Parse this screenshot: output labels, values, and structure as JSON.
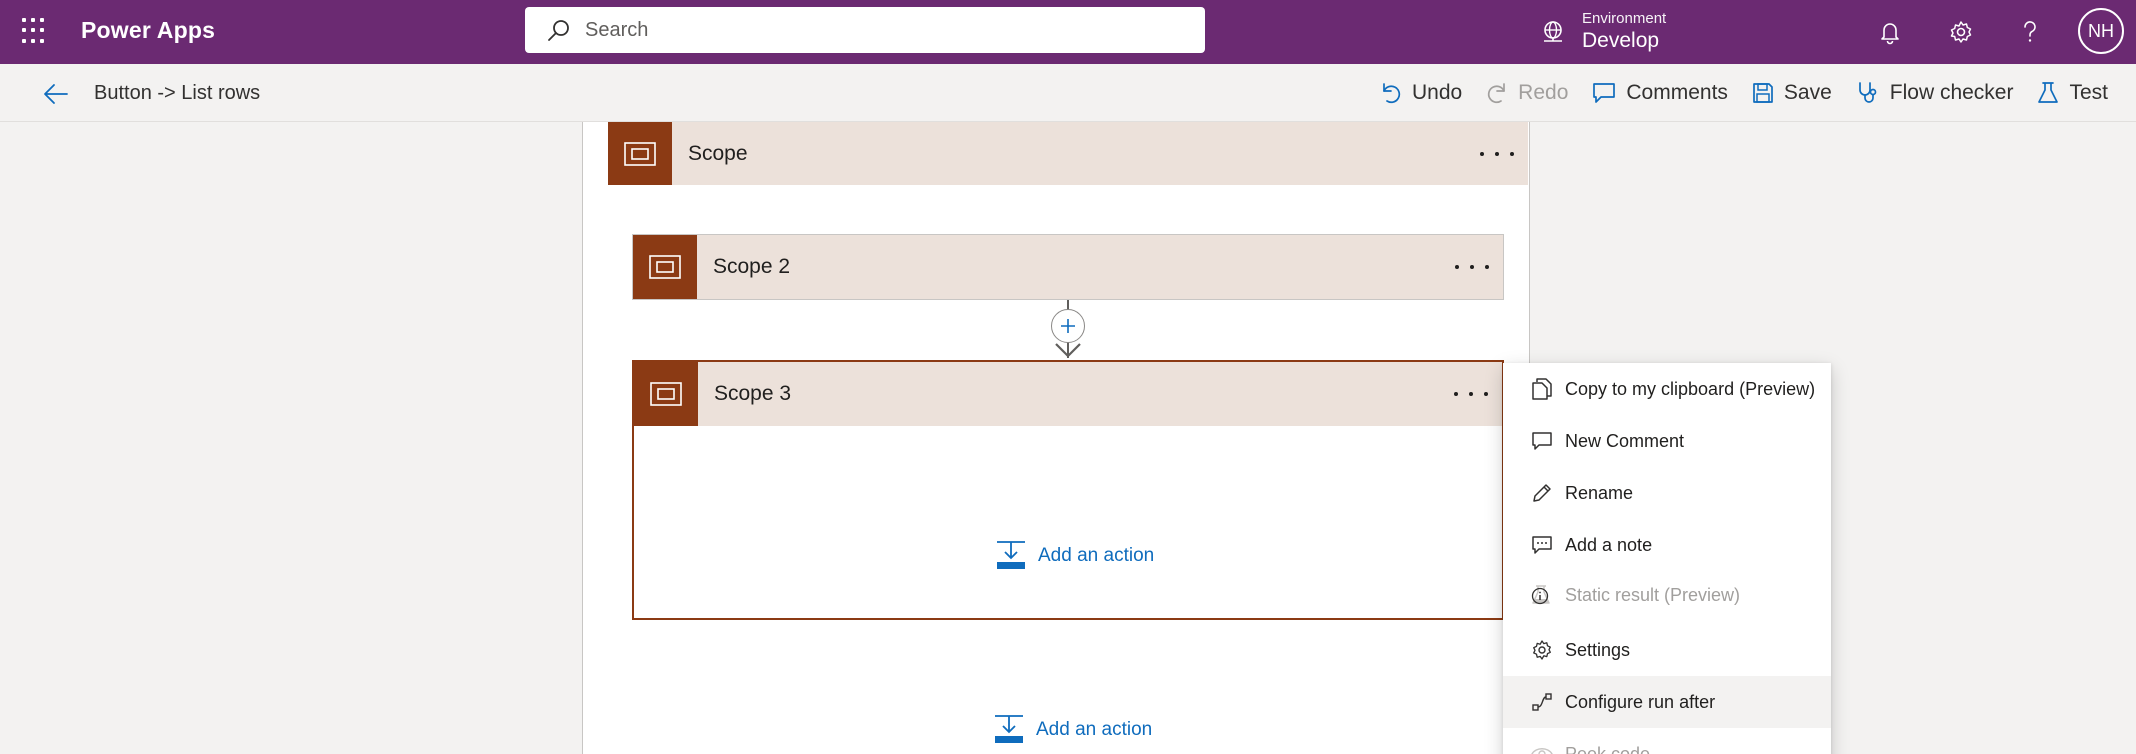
{
  "topbar": {
    "app_name": "Power Apps",
    "search_placeholder": "Search",
    "environment_label": "Environment",
    "environment_value": "Develop",
    "avatar_initials": "NH",
    "bg_color": "#6b2a72"
  },
  "cmdbar": {
    "breadcrumb": "Button -> List rows",
    "undo": "Undo",
    "redo": "Redo",
    "comments": "Comments",
    "save": "Save",
    "flow_checker": "Flow checker",
    "test": "Test"
  },
  "canvas": {
    "scope_title": "Scope",
    "scope2_title": "Scope 2",
    "scope3_title": "Scope 3",
    "add_action_inner": "Add an action",
    "add_action_outer": "Add an action",
    "accent_color": "#8b3a14"
  },
  "menu": {
    "items": [
      {
        "label": "Copy to my clipboard (Preview)",
        "icon": "copy-icon",
        "disabled": false
      },
      {
        "label": "New Comment",
        "icon": "comment-icon",
        "disabled": false
      },
      {
        "label": "Rename",
        "icon": "pencil-icon",
        "disabled": false
      },
      {
        "label": "Add a note",
        "icon": "note-icon",
        "disabled": false
      },
      {
        "label": "Static result (Preview)",
        "icon": "flask-icon",
        "disabled": true
      },
      {
        "label": "Settings",
        "icon": "gear-icon",
        "disabled": false
      },
      {
        "label": "Configure run after",
        "icon": "run-after-icon",
        "disabled": false
      },
      {
        "label": "Peek code",
        "icon": "eye-icon",
        "disabled": true
      }
    ]
  }
}
